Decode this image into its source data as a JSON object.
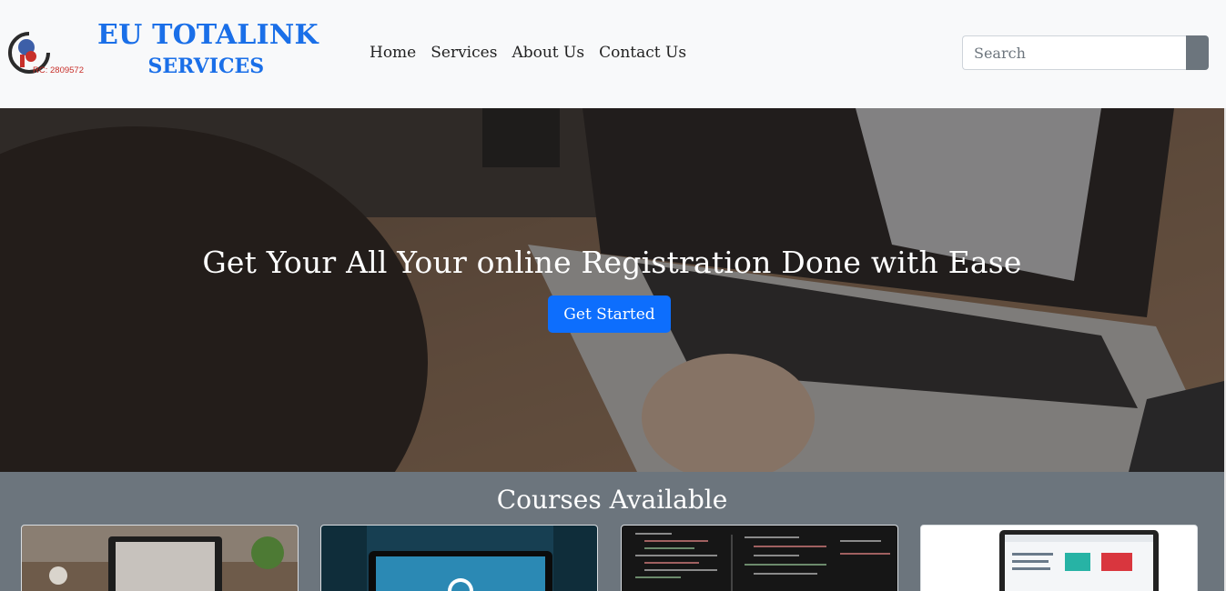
{
  "header": {
    "brand_line1": "EU TOTALINK",
    "brand_line2": "SERVICES",
    "logo_rc": "RC: 2809572",
    "nav": [
      "Home",
      "Services",
      "About Us",
      "Contact Us"
    ],
    "search_placeholder": "Search"
  },
  "hero": {
    "title": "Get Your All Your online Registration Done with Ease",
    "cta_label": "Get Started"
  },
  "courses": {
    "heading": "Courses Available",
    "cards": [
      "laptop-on-desk-image",
      "wordpress-laptop-image",
      "code-screen-image",
      "website-screenshot-image"
    ]
  },
  "colors": {
    "brand": "#1a6fe8",
    "primary_button": "#0d6efd",
    "section_bg": "#6c757d",
    "navbar_bg": "#f8f9fa"
  }
}
